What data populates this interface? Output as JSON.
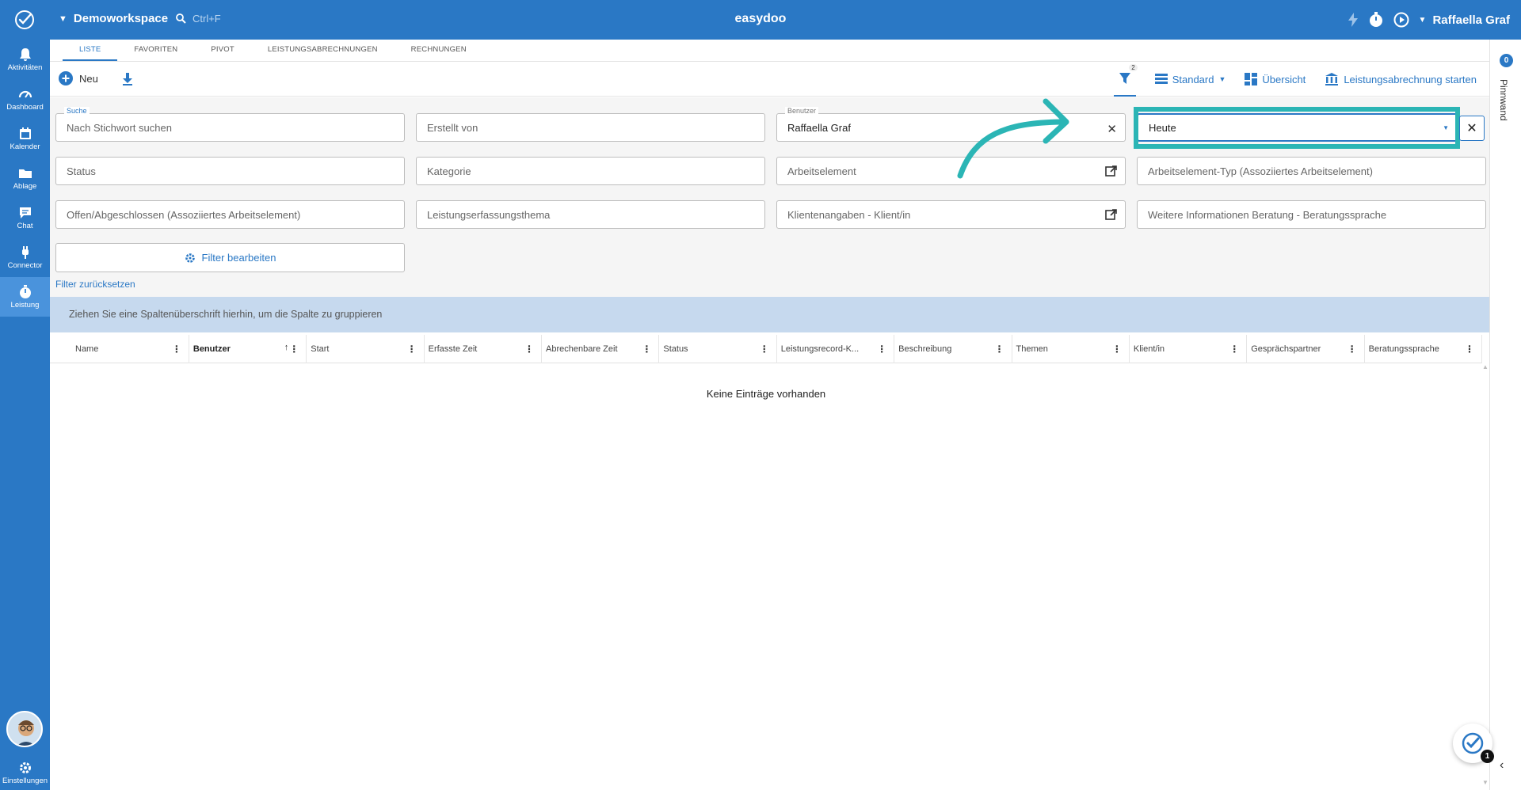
{
  "topbar": {
    "workspace": "Demoworkspace",
    "search_hint": "Ctrl+F",
    "app_title": "easydoo",
    "user_name": "Raffaella Graf"
  },
  "sidebar": {
    "items": [
      {
        "label": "Aktivitäten",
        "icon": "bell-icon"
      },
      {
        "label": "Dashboard",
        "icon": "gauge-icon"
      },
      {
        "label": "Kalender",
        "icon": "calendar-icon"
      },
      {
        "label": "Ablage",
        "icon": "folder-icon"
      },
      {
        "label": "Chat",
        "icon": "chat-icon"
      },
      {
        "label": "Connector",
        "icon": "plug-icon"
      },
      {
        "label": "Leistung",
        "icon": "stopwatch-icon"
      }
    ],
    "settings_label": "Einstellungen"
  },
  "rightrail": {
    "badge": "0",
    "label": "Pinnwand"
  },
  "tabs": [
    "LISTE",
    "FAVORITEN",
    "PIVOT",
    "LEISTUNGSABRECHNUNGEN",
    "RECHNUNGEN"
  ],
  "toolbar": {
    "new_label": "Neu",
    "filter_count": "2",
    "view_label": "Standard",
    "overview_label": "Übersicht",
    "billing_label": "Leistungsabrechnung starten"
  },
  "filters": {
    "search_label": "Suche",
    "search_placeholder": "Nach Stichwort suchen",
    "created_by": "Erstellt von",
    "user_label": "Benutzer",
    "user_value": "Raffaella Graf",
    "date_value": "Heute",
    "status": "Status",
    "category": "Kategorie",
    "work_element": "Arbeitselement",
    "work_element_type": "Arbeitselement-Typ (Assoziiertes Arbeitselement)",
    "open_closed": "Offen/Abgeschlossen (Assoziiertes Arbeitselement)",
    "service_topic": "Leistungserfassungsthema",
    "client": "Klientenangaben - Klient/in",
    "language": "Weitere Informationen Beratung - Beratungssprache",
    "edit_filter": "Filter bearbeiten",
    "reset": "Filter zurücksetzen"
  },
  "grid": {
    "group_hint": "Ziehen Sie eine Spaltenüberschrift hierhin, um die Spalte zu gruppieren",
    "columns": [
      "Name",
      "Benutzer",
      "Start",
      "Erfasste Zeit",
      "Abrechenbare Zeit",
      "Status",
      "Leistungsrecord-K...",
      "Beschreibung",
      "Themen",
      "Klient/in",
      "Gesprächspartner",
      "Beratungssprache"
    ],
    "empty": "Keine Einträge vorhanden"
  },
  "fab": {
    "badge": "1"
  },
  "colors": {
    "brand": "#2a78c5",
    "highlight": "#2bb5b5"
  }
}
